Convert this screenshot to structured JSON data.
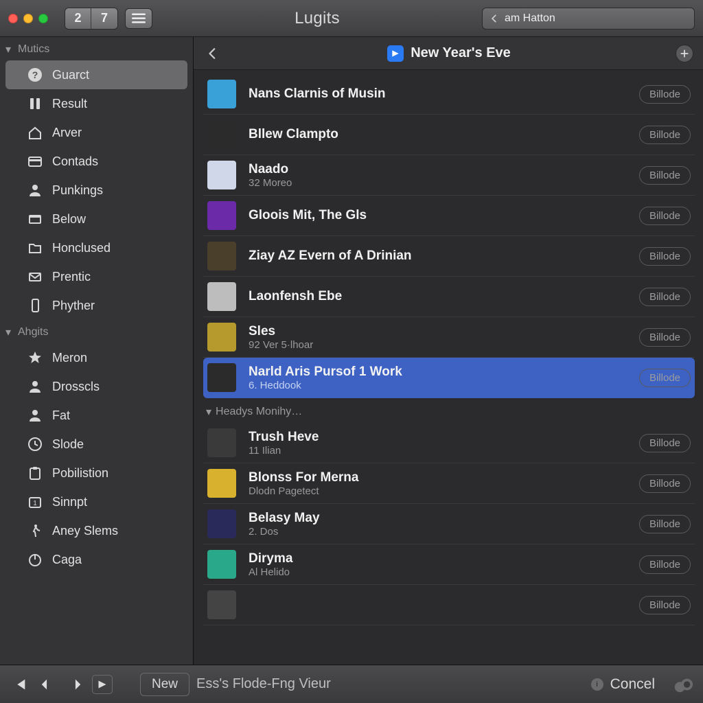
{
  "window": {
    "title": "Lugits",
    "seg_left": "2",
    "seg_right": "7"
  },
  "search": {
    "value": "am Hatton"
  },
  "sidebar": {
    "sections": [
      {
        "header": "Mutics",
        "items": [
          {
            "icon": "question",
            "label": "Guarct",
            "active": true
          },
          {
            "icon": "pause",
            "label": "Result"
          },
          {
            "icon": "house",
            "label": "Arver"
          },
          {
            "icon": "card",
            "label": "Contads"
          },
          {
            "icon": "person",
            "label": "Punkings"
          },
          {
            "icon": "rect",
            "label": "Below"
          },
          {
            "icon": "folder",
            "label": "Honclused"
          },
          {
            "icon": "mail",
            "label": "Prentic"
          },
          {
            "icon": "phone",
            "label": "Phyther"
          }
        ]
      },
      {
        "header": "Ahgits",
        "items": [
          {
            "icon": "star",
            "label": "Meron"
          },
          {
            "icon": "person",
            "label": "Drosscls"
          },
          {
            "icon": "personf",
            "label": "Fat"
          },
          {
            "icon": "clock",
            "label": "Slode"
          },
          {
            "icon": "clip",
            "label": "Pobilistion"
          },
          {
            "icon": "cal",
            "label": "Sinnpt"
          },
          {
            "icon": "walk",
            "label": "Aney Slems"
          },
          {
            "icon": "power",
            "label": "Caga"
          }
        ]
      }
    ]
  },
  "content": {
    "header_title": "New Year's Eve",
    "section2_header": "Headys Monihy…",
    "action_label": "Billode",
    "tracks1": [
      {
        "title": "Nans Clarnis of Musin",
        "sub": "",
        "art": "#3aa0d8",
        "selected": false
      },
      {
        "title": "Bllew Clampto",
        "sub": "",
        "art": "#2b2b2b",
        "selected": false
      },
      {
        "title": "Naado",
        "sub": "32 Moreo",
        "art": "#cfd7e8",
        "selected": false
      },
      {
        "title": "Gloois Mit, The Gls",
        "sub": "",
        "art": "#6b2aa8",
        "selected": false
      },
      {
        "title": "Ziay AZ Evern of A Drinian",
        "sub": "",
        "art": "#4a3f2a",
        "selected": false
      },
      {
        "title": "Laonfensh Ebe",
        "sub": "",
        "art": "#bdbdbd",
        "selected": false
      },
      {
        "title": "Sles",
        "sub": "92 Ver 5·lhoar",
        "art": "#b79a2e",
        "selected": false
      },
      {
        "title": "Narld Aris Pursof 1 Work",
        "sub": "6. Heddook",
        "art": "#2b2b2b",
        "selected": true
      }
    ],
    "tracks2": [
      {
        "title": "Trush Heve",
        "sub": "11 Ilian",
        "art": "#3a3a3a"
      },
      {
        "title": "Blonss For Merna",
        "sub": "Dlodn Pagetect",
        "art": "#d8b22e"
      },
      {
        "title": "Belasy May",
        "sub": "2. Dos",
        "art": "#2a2a5a"
      },
      {
        "title": "Diryma",
        "sub": "Al Helido",
        "art": "#2aa88a"
      },
      {
        "title": "",
        "sub": "",
        "art": "#444"
      }
    ]
  },
  "bottom": {
    "new_label": "New",
    "now_playing": "Ess's Flode-Fng Vieur",
    "cancel_label": "Concel"
  }
}
